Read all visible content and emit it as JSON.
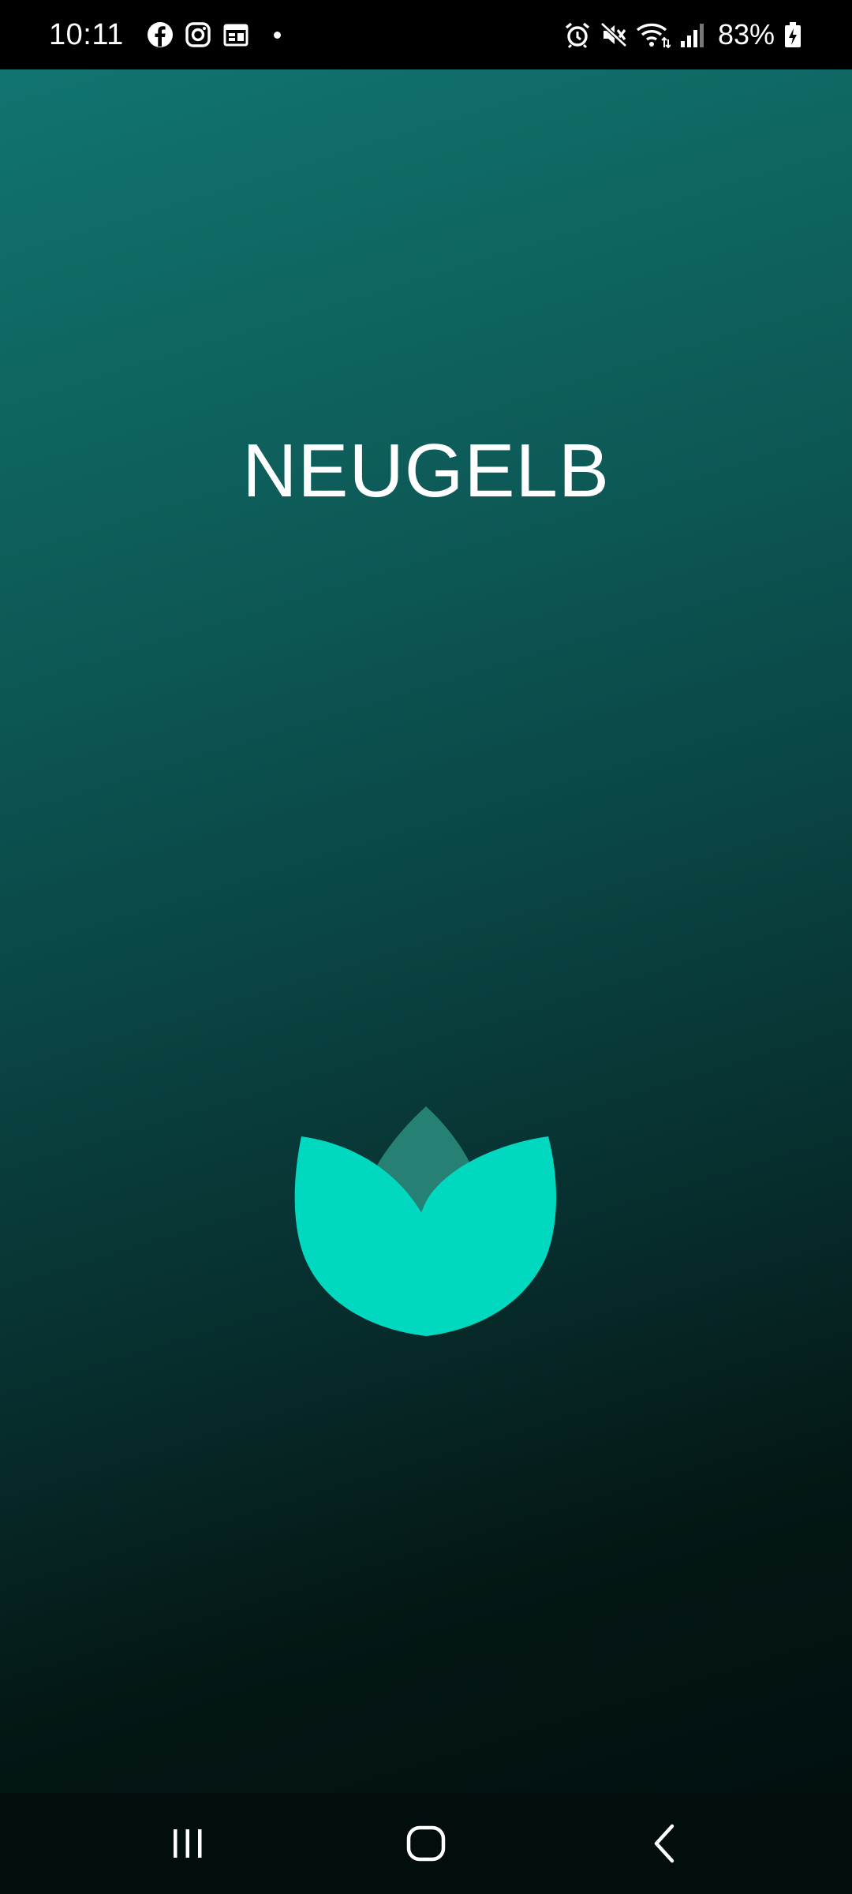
{
  "status_bar": {
    "time": "10:11",
    "left_icons": [
      "facebook-icon",
      "instagram-icon",
      "calendar-icon",
      "notification-dot"
    ],
    "right_icons": [
      "alarm-icon",
      "mute-icon",
      "wifi-icon",
      "signal-icon",
      "battery-charging-icon"
    ],
    "battery": "83%"
  },
  "app": {
    "title": "NEUGELB",
    "logo": "leaf-logo",
    "colors": {
      "gradient_top": "#117470",
      "gradient_bottom": "#021010",
      "logo_primary": "#00d8c0",
      "logo_secondary": "#268074"
    }
  },
  "navigation_bar": {
    "buttons": [
      "recents-button",
      "home-button",
      "back-button"
    ]
  }
}
